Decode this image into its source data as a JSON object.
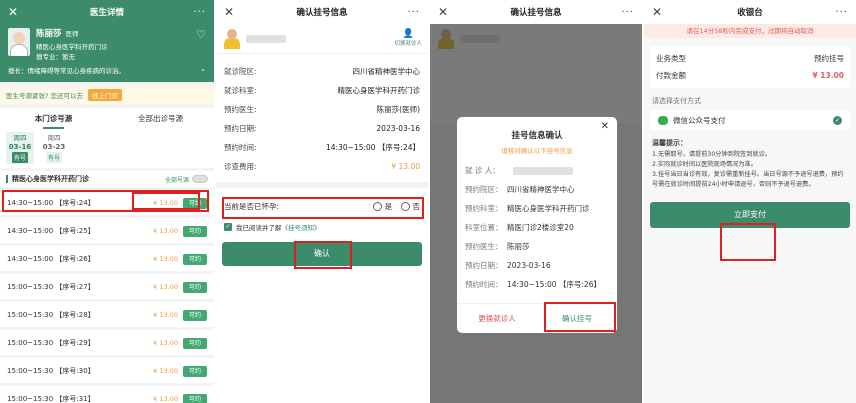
{
  "panel1": {
    "title": "医生详情",
    "close": "✕",
    "more": "···",
    "doctor": {
      "name": "陈丽莎",
      "title": "医师",
      "dept": "精医心身医学科开药门诊",
      "specialty": "擅专业：暂无",
      "intro": "擅长：情绪障碍等常见心身疾病的诊治。"
    },
    "notice_text": "医生号源紧张? 您还可以去",
    "notice_btn": "线上门诊",
    "tabs": [
      "本门诊号源",
      "全部出诊号源"
    ],
    "dates": [
      {
        "week": "周四",
        "date": "03-16",
        "tag": "有号"
      },
      {
        "week": "周四",
        "date": "03-23",
        "tag": "有号"
      }
    ],
    "dept_name": "精医心身医学科开药门诊",
    "all_sources": "全部号源",
    "slots": [
      {
        "time": "14:30~15:00 【序号:24】",
        "price": "¥ 13.00",
        "btn": "可约"
      },
      {
        "time": "14:30~15:00 【序号:25】",
        "price": "¥ 13.00",
        "btn": "可约"
      },
      {
        "time": "14:30~15:00 【序号:26】",
        "price": "¥ 13.00",
        "btn": "可约"
      },
      {
        "time": "15:00~15:30 【序号:27】",
        "price": "¥ 13.00",
        "btn": "可约"
      },
      {
        "time": "15:00~15:30 【序号:28】",
        "price": "¥ 13.00",
        "btn": "可约"
      },
      {
        "time": "15:00~15:30 【序号:29】",
        "price": "¥ 13.00",
        "btn": "可约"
      },
      {
        "time": "15:00~15:30 【序号:30】",
        "price": "¥ 13.00",
        "btn": "可约"
      },
      {
        "time": "15:00~15:30 【序号:31】",
        "price": "¥ 13.00",
        "btn": "可约"
      }
    ]
  },
  "panel2": {
    "title": "确认挂号信息",
    "close": "✕",
    "more": "···",
    "switch_label": "切换就诊人",
    "rows": [
      {
        "k": "就诊院区:",
        "v": "四川省精神医学中心"
      },
      {
        "k": "就诊科室:",
        "v": "精医心身医学科开药门诊"
      },
      {
        "k": "预约医生:",
        "v": "陈丽莎(医师)"
      },
      {
        "k": "预约日期:",
        "v": "2023-03-16"
      },
      {
        "k": "预约时间:",
        "v": "14:30~15:00 【序号:24】"
      },
      {
        "k": "诊查费用:",
        "v": "¥ 13.00"
      }
    ],
    "pregnant_q": "当前是否已怀孕:",
    "yes": "是",
    "no": "否",
    "agree_text": "我已阅读并了解",
    "agree_link": "《挂号须知》",
    "confirm": "确认"
  },
  "panel3": {
    "title": "确认挂号信息",
    "close": "✕",
    "more": "···",
    "modal_title": "挂号信息确认",
    "modal_sub": "请核对确认以下挂号信息",
    "rows": [
      {
        "k": "就 诊 人：",
        "v": ""
      },
      {
        "k": "预约院区：",
        "v": "四川省精神医学中心"
      },
      {
        "k": "预约科室：",
        "v": "精医心身医学科开药门诊"
      },
      {
        "k": "科室位置：",
        "v": "精医门诊2楼诊室20"
      },
      {
        "k": "预约医生：",
        "v": "陈丽莎"
      },
      {
        "k": "预约日期：",
        "v": "2023-03-16"
      },
      {
        "k": "预约时间：",
        "v": "14:30~15:00 【序号:26】"
      }
    ],
    "change": "更换就诊人",
    "confirm": "确认挂号"
  },
  "panel4": {
    "title": "收银台",
    "close": "✕",
    "more": "···",
    "countdown": "请在14分58秒内完成支付，过期将自动取消",
    "biz_type_k": "业务类型",
    "biz_type_v": "预约挂号",
    "amount_k": "付款金额",
    "amount_v": "¥ 13.00",
    "pay_label": "请选择支付方式",
    "wechat": "微信公众号支付",
    "tips_title": "温馨提示：",
    "tips": [
      "1.无需取号，请提前30分钟到院签到就诊。",
      "2.实际就诊时间以医院现场情况为准。",
      "3.挂号当日当诊有效，复诊需重新挂号。当日号源不予退号退费，预约号需在就诊时间提前24小时申请退号，否则不予退号退费。"
    ],
    "pay_btn": "立即支付"
  }
}
